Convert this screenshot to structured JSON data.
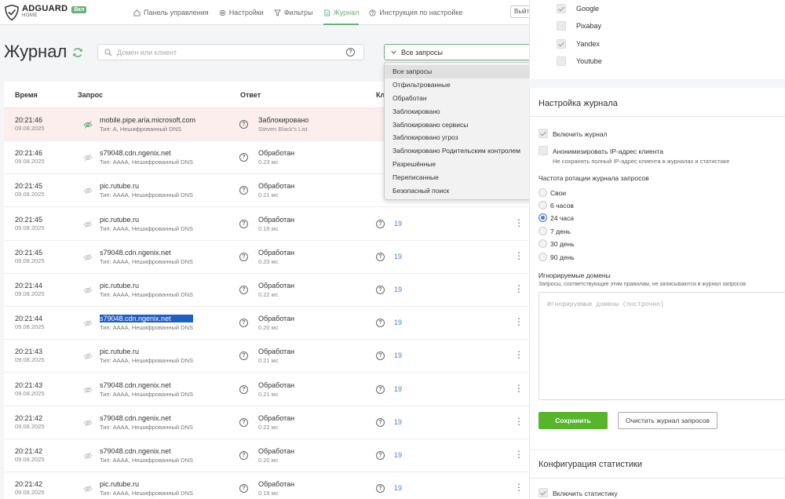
{
  "header": {
    "logo_name": "ADGUARD",
    "logo_sub": "HOME",
    "badge": "Вкл",
    "nav": [
      {
        "label": "Панель управления",
        "icon": "home-icon"
      },
      {
        "label": "Настройки",
        "icon": "gear-icon"
      },
      {
        "label": "Фильтры",
        "icon": "filter-icon"
      },
      {
        "label": "Журнал",
        "icon": "document-icon",
        "active": true
      },
      {
        "label": "Инструкция по настройке",
        "icon": "help-icon"
      }
    ],
    "exit_label": "Выйт"
  },
  "log": {
    "title": "Журнал",
    "search_placeholder": "Домен или клиент",
    "filter_value": "Все запросы",
    "columns": [
      "Время",
      "Запрос",
      "Ответ",
      "Кл"
    ],
    "dropdown_options": [
      "Все запросы",
      "Отфильтрованные",
      "Обработан",
      "Заблокировано",
      "Заблокировано сервисы",
      "Заблокировано угроз",
      "Заблокировано Родительским контролем",
      "Разрешённые",
      "Переписанные",
      "Безопасный поиск"
    ],
    "rows": [
      {
        "time": "20:21:46",
        "date": "09.08.2025",
        "domain": "mobile.pipe.aria.microsoft.com",
        "type": "Тип: A, Нешифрованный DNS",
        "status": "Заблокировано",
        "sub": "Steven Black's List",
        "client": "",
        "blocked": true
      },
      {
        "time": "20:21:46",
        "date": "09.08.2025",
        "domain": "s79048.cdn.ngenix.net",
        "type": "Тип: AAAA, Нешифрованный DNS",
        "status": "Обработан",
        "sub": "0.23 мс",
        "client": ""
      },
      {
        "time": "20:21:45",
        "date": "09.08.2025",
        "domain": "pic.rutube.ru",
        "type": "Тип: AAAA, Нешифрованный DNS",
        "status": "Обработан",
        "sub": "0.21 мс",
        "client": ""
      },
      {
        "time": "20:21:45",
        "date": "09.08.2025",
        "domain": "pic.rutube.ru",
        "type": "Тип: AAAA, Нешифрованный DNS",
        "status": "Обработан",
        "sub": "0.19 мс",
        "client": "19"
      },
      {
        "time": "20:21:45",
        "date": "09.08.2025",
        "domain": "s79048.cdn.ngenix.net",
        "type": "Тип: AAAA, Нешифрованный DNS",
        "status": "Обработан",
        "sub": "0.23 мс",
        "client": "19"
      },
      {
        "time": "20:21:44",
        "date": "09.08.2025",
        "domain": "pic.rutube.ru",
        "type": "Тип: AAAA, Нешифрованный DNS",
        "status": "Обработан",
        "sub": "0.22 мс",
        "client": "19"
      },
      {
        "time": "20:21:44",
        "date": "09.08.2025",
        "domain": "s79048.cdn.ngenix.net",
        "type": "Тип: AAAA, Нешифрованный DNS",
        "status": "Обработан",
        "sub": "0.20 мс",
        "client": "19",
        "highlight": true
      },
      {
        "time": "20:21:43",
        "date": "09.08.2025",
        "domain": "pic.rutube.ru",
        "type": "Тип: AAAA, Нешифрованный DNS",
        "status": "Обработан",
        "sub": "0.21 мс",
        "client": "19"
      },
      {
        "time": "20:21:43",
        "date": "09.08.2025",
        "domain": "s79048.cdn.ngenix.net",
        "type": "Тип: AAAA, Нешифрованный DNS",
        "status": "Обработан",
        "sub": "0.21 мс",
        "client": "19"
      },
      {
        "time": "20:21:42",
        "date": "09.08.2025",
        "domain": "s79048.cdn.ngenix.net",
        "type": "Тип: AAAA, Нешифрованный DNS",
        "status": "Обработан",
        "sub": "0.22 мс",
        "client": "19"
      },
      {
        "time": "20:21:42",
        "date": "09.08.2025",
        "domain": "s79048.cdn.ngenix.net",
        "type": "Тип: AAAA, Нешифрованный DNS",
        "status": "Обработан",
        "sub": "0.20 мс",
        "client": "19"
      },
      {
        "time": "20:21:42",
        "date": "09.08.2025",
        "domain": "pic.rutube.ru",
        "type": "Тип: AAAA, Нешифрованный DNS",
        "status": "Обработан",
        "sub": "0.19 мс",
        "client": "19"
      }
    ]
  },
  "services": [
    {
      "label": "Google",
      "checked": true
    },
    {
      "label": "Pixabay",
      "checked": false
    },
    {
      "label": "Yandex",
      "checked": true
    },
    {
      "label": "Youtube",
      "checked": false
    }
  ],
  "log_settings": {
    "title": "Настройка журнала",
    "enable_log": "Включить журнал",
    "anonymize": "Анонимизировать IP-адрес клиента",
    "anonymize_desc": "Не сохранять полный IP-адрес клиента в журналах и статистике",
    "rotation_label": "Частота ротации журнала запросов",
    "rotation_options": [
      "Свои",
      "6 часов",
      "24 часа",
      "7 день",
      "30 день",
      "90 день"
    ],
    "rotation_selected": "24 часа",
    "ignored_title": "Игнорируемые домены",
    "ignored_hint": "Запросы, соответствующие этим правилам, не записываются в журнал запросов",
    "ignored_placeholder": "Игнорируемые домены (построчно)",
    "save": "Сохранить",
    "clear": "Очистить журнал запросов"
  },
  "stats_settings": {
    "title": "Конфигурация статистики",
    "enable_stats": "Включить статистику"
  },
  "colors": {
    "accent": "#67b279",
    "save_button": "#57b52b",
    "blocked_row": "#fbeeed",
    "link": "#467fcf"
  }
}
